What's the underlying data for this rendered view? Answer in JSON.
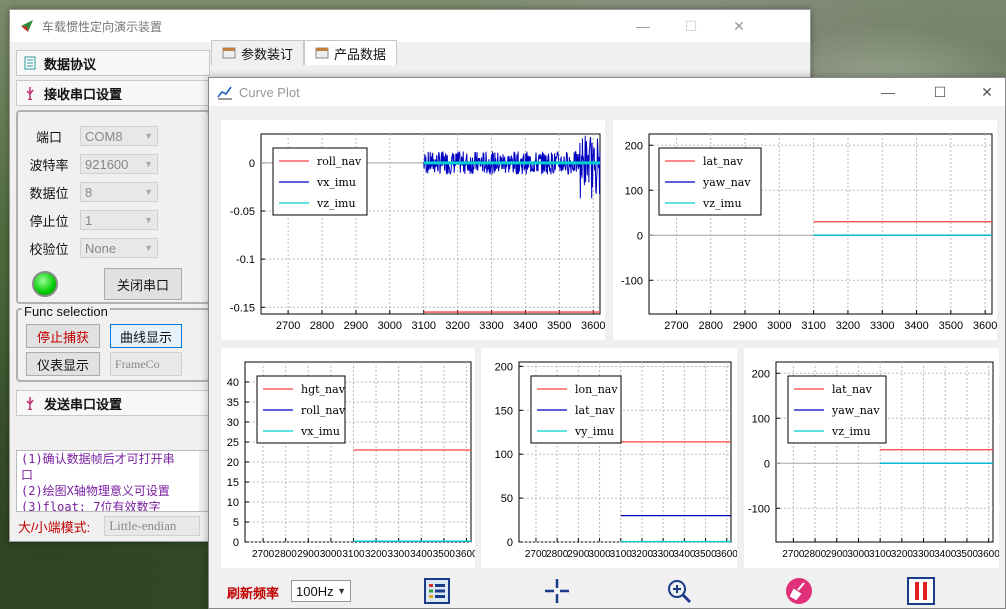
{
  "main_window": {
    "title": "车载惯性定向演示装置"
  },
  "tabs": [
    {
      "label": "参数装订"
    },
    {
      "label": "产品数据"
    }
  ],
  "left_panel": {
    "data_protocol": "数据协议",
    "recv_serial": "接收串口设置",
    "send_serial": "发送串口设置",
    "fields": [
      {
        "label": "端口",
        "value": "COM8"
      },
      {
        "label": "波特率",
        "value": "921600"
      },
      {
        "label": "数据位",
        "value": "8"
      },
      {
        "label": "停止位",
        "value": "1"
      },
      {
        "label": "校验位",
        "value": "None"
      }
    ],
    "close_port": "关闭串口",
    "status_color": "#00cc00",
    "func_selection": "Func selection",
    "stop_capture": "停止捕获",
    "curve_display": "曲线显示",
    "meter_display": "仪表显示",
    "frame_combo": "FrameCo",
    "messages": [
      "(1)确认数据帧后才可打开串",
      "口",
      "(2)绘图X轴物理意义可设置",
      "(3)float: 7位有效数字"
    ],
    "endian_label": "大/小端模式:",
    "endian_value": "Little-endian"
  },
  "plot_window": {
    "title": "Curve Plot",
    "refresh_label": "刷新频率",
    "refresh_value": "100Hz",
    "tools": [
      "list-icon",
      "crosshair-icon",
      "zoom-in-icon",
      "clear-brush-icon",
      "pause-icon"
    ]
  },
  "chart_data": [
    {
      "type": "line",
      "xlim": [
        2620,
        3620
      ],
      "ylim": [
        -0.157,
        0.03
      ],
      "xticks": [
        2700,
        2800,
        2900,
        3000,
        3100,
        3200,
        3300,
        3400,
        3500,
        3600
      ],
      "yticks": [
        0,
        -0.05,
        -0.1,
        -0.15
      ],
      "ytick_labels": [
        "0",
        "-0.05",
        "-0.1",
        "-0.15"
      ],
      "series": [
        {
          "name": "roll_nav",
          "color": "#ff4040",
          "kind": "flat",
          "x": [
            3100,
            3620
          ],
          "y": -0.155
        },
        {
          "name": "vx_imu",
          "color": "#0000c0",
          "kind": "noise",
          "x": [
            3100,
            3620
          ],
          "y": 0,
          "amp": 0.012
        },
        {
          "name": "vz_imu",
          "color": "#00d0d0",
          "kind": "flat",
          "x": [
            3100,
            3620
          ],
          "y": 0
        }
      ],
      "ref_line": {
        "x": [
          2620,
          3100
        ],
        "y": 0
      }
    },
    {
      "type": "line",
      "xlim": [
        2620,
        3620
      ],
      "ylim": [
        -175,
        225
      ],
      "xticks": [
        2700,
        2800,
        2900,
        3000,
        3100,
        3200,
        3300,
        3400,
        3500,
        3600
      ],
      "yticks": [
        200,
        100,
        0,
        -100
      ],
      "ytick_labels": [
        "200",
        "100",
        "0",
        "-100"
      ],
      "series": [
        {
          "name": "lat_nav",
          "color": "#ff4040",
          "kind": "flat",
          "x": [
            3100,
            3620
          ],
          "y": 30
        },
        {
          "name": "yaw_nav",
          "color": "#0000c0",
          "kind": "flat",
          "x": [
            3100,
            3620
          ],
          "y": 0
        },
        {
          "name": "vz_imu",
          "color": "#00d0d0",
          "kind": "flat",
          "x": [
            3100,
            3620
          ],
          "y": 0
        }
      ],
      "ref_line": {
        "x": [
          2620,
          3100
        ],
        "y": 0
      }
    },
    {
      "type": "line",
      "xlim": [
        2620,
        3620
      ],
      "ylim": [
        0,
        45
      ],
      "xticks": [
        2700,
        2800,
        2900,
        3000,
        3100,
        3200,
        3300,
        3400,
        3500,
        3600
      ],
      "yticks": [
        40,
        35,
        30,
        25,
        20,
        15,
        10,
        5,
        0
      ],
      "ytick_labels": [
        "40",
        "35",
        "30",
        "25",
        "20",
        "15",
        "10",
        "5",
        "0"
      ],
      "series": [
        {
          "name": "hgt_nav",
          "color": "#ff4040",
          "kind": "flat",
          "x": [
            3100,
            3620
          ],
          "y": 23
        },
        {
          "name": "roll_nav",
          "color": "#0000c0",
          "kind": "flat",
          "x": [
            3100,
            3620
          ],
          "y": 0.2
        },
        {
          "name": "vx_imu",
          "color": "#00d0d0",
          "kind": "flat",
          "x": [
            3100,
            3620
          ],
          "y": 0.2
        }
      ]
    },
    {
      "type": "line",
      "xlim": [
        2620,
        3620
      ],
      "ylim": [
        0,
        205
      ],
      "xticks": [
        2700,
        2800,
        2900,
        3000,
        3100,
        3200,
        3300,
        3400,
        3500,
        3600
      ],
      "yticks": [
        200,
        150,
        100,
        50,
        0
      ],
      "ytick_labels": [
        "200",
        "150",
        "100",
        "50",
        "0"
      ],
      "series": [
        {
          "name": "lon_nav",
          "color": "#ff4040",
          "kind": "flat",
          "x": [
            3100,
            3620
          ],
          "y": 114
        },
        {
          "name": "lat_nav",
          "color": "#0000c0",
          "kind": "flat",
          "x": [
            3100,
            3620
          ],
          "y": 30
        },
        {
          "name": "vy_imu",
          "color": "#00d0d0",
          "kind": "flat",
          "x": [
            3100,
            3620
          ],
          "y": 0.5
        }
      ]
    },
    {
      "type": "line",
      "xlim": [
        2620,
        3620
      ],
      "ylim": [
        -175,
        225
      ],
      "xticks": [
        2700,
        2800,
        2900,
        3000,
        3100,
        3200,
        3300,
        3400,
        3500,
        3600
      ],
      "yticks": [
        200,
        100,
        0,
        -100
      ],
      "ytick_labels": [
        "200",
        "100",
        "0",
        "-100"
      ],
      "series": [
        {
          "name": "lat_nav",
          "color": "#ff4040",
          "kind": "flat",
          "x": [
            3100,
            3620
          ],
          "y": 30
        },
        {
          "name": "yaw_nav",
          "color": "#0000c0",
          "kind": "flat",
          "x": [
            3100,
            3620
          ],
          "y": 0
        },
        {
          "name": "vz_imu",
          "color": "#00d0d0",
          "kind": "flat",
          "x": [
            3100,
            3620
          ],
          "y": 0
        }
      ],
      "ref_line": {
        "x": [
          2620,
          3100
        ],
        "y": 0
      }
    }
  ]
}
